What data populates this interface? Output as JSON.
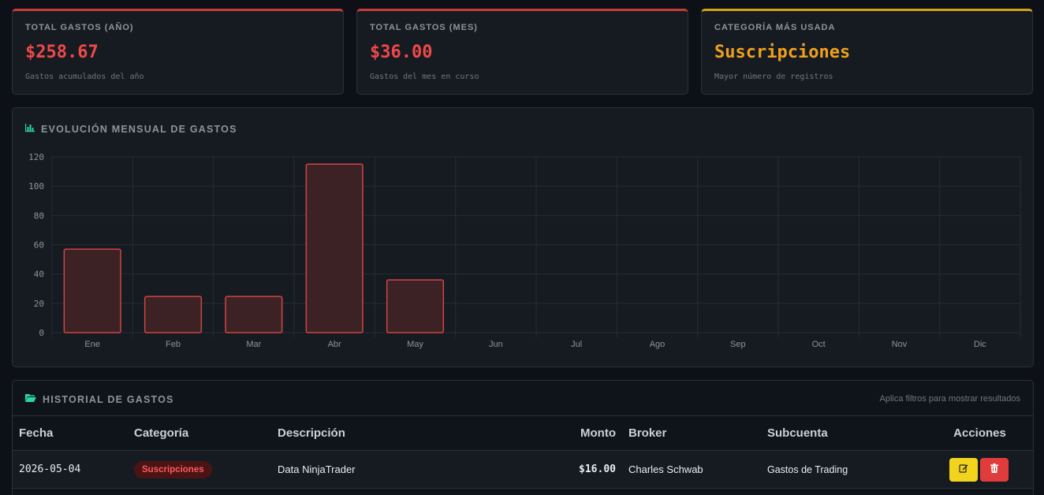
{
  "stats": [
    {
      "label": "TOTAL GASTOS (AÑO)",
      "value": "$258.67",
      "sub": "Gastos acumulados del año",
      "accent": "#c93c3c"
    },
    {
      "label": "TOTAL GASTOS (MES)",
      "value": "$36.00",
      "sub": "Gastos del mes en curso",
      "accent": "#c93c3c"
    },
    {
      "label": "CATEGORÍA MÁS USADA",
      "value": "Suscripciones",
      "sub": "Mayor número de registros",
      "accent": "#d4a017"
    }
  ],
  "chart_section": {
    "title": "EVOLUCIÓN MENSUAL DE GASTOS",
    "icon": "bar-chart-icon"
  },
  "chart_data": {
    "type": "bar",
    "categories": [
      "Ene",
      "Feb",
      "Mar",
      "Abr",
      "May",
      "Jun",
      "Jul",
      "Ago",
      "Sep",
      "Oct",
      "Nov",
      "Dic"
    ],
    "values": [
      57,
      24.67,
      24.67,
      115,
      36,
      0,
      0,
      0,
      0,
      0,
      0,
      0
    ],
    "yticks": [
      0,
      20,
      40,
      60,
      80,
      100,
      120
    ],
    "ylim": [
      0,
      120
    ],
    "grid": true,
    "bar_fill": "#3d2225",
    "bar_stroke": "#d04444"
  },
  "history": {
    "title": "HISTORIAL DE GASTOS",
    "icon": "folder-open-icon",
    "hint": "Aplica filtros para mostrar resultados",
    "columns": {
      "fecha": "Fecha",
      "categoria": "Categoría",
      "descripcion": "Descripción",
      "monto": "Monto",
      "broker": "Broker",
      "subcuenta": "Subcuenta",
      "acciones": "Acciones"
    },
    "rows": [
      {
        "fecha": "2026-05-04",
        "categoria": "Suscripciones",
        "descripcion": "Data NinjaTrader",
        "monto": "$16.00",
        "broker": "Charles Schwab",
        "subcuenta": "Gastos de Trading"
      }
    ]
  },
  "colors": {
    "accent_red": "#f04848",
    "accent_orange": "#f0a01c",
    "teal": "#2dd4a8",
    "edit": "#f2d41c",
    "delete": "#e03c3c"
  }
}
